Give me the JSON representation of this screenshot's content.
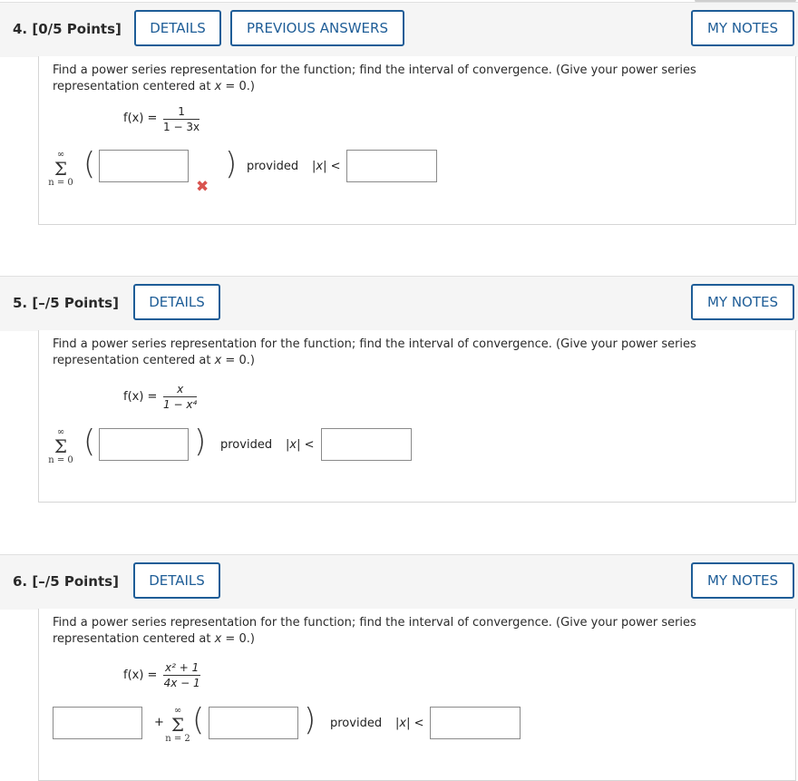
{
  "questions": [
    {
      "number_label": "4. [0/5 Points]",
      "details_label": "DETAILS",
      "previous_answers_label": "PREVIOUS ANSWERS",
      "my_notes_label": "MY NOTES",
      "prompt_part1": "Find a power series representation for the function; find the interval of convergence. (Give your power series representation centered at ",
      "prompt_var": "x",
      "prompt_part2": " = 0.)",
      "fx_label": "f(x) =",
      "numerator": "1",
      "denominator": "1 − 3x",
      "sum_upper": "∞",
      "sum_symbol": "Σ",
      "sum_lower": "n = 0",
      "provided_label": "provided",
      "abs_x": "|x| <",
      "status": "incorrect",
      "status_icon": "✖"
    },
    {
      "number_label": "5. [–/5 Points]",
      "details_label": "DETAILS",
      "my_notes_label": "MY NOTES",
      "prompt_part1": "Find a power series representation for the function; find the interval of convergence. (Give your power series representation centered at ",
      "prompt_var": "x",
      "prompt_part2": " = 0.)",
      "fx_label": "f(x) =",
      "numerator": "x",
      "denominator": "1 − x⁴",
      "sum_upper": "∞",
      "sum_symbol": "Σ",
      "sum_lower": "n = 0",
      "provided_label": "provided",
      "abs_x": "|x| <"
    },
    {
      "number_label": "6. [–/5 Points]",
      "details_label": "DETAILS",
      "my_notes_label": "MY NOTES",
      "prompt_part1": "Find a power series representation for the function; find the interval of convergence. (Give your power series representation centered at ",
      "prompt_var": "x",
      "prompt_part2": " = 0.)",
      "fx_label": "f(x) =",
      "numerator": "x² + 1",
      "denominator": "4x − 1",
      "plus": "+",
      "sum_upper": "∞",
      "sum_symbol": "Σ",
      "sum_lower": "n = 2",
      "provided_label": "provided",
      "abs_x": "|x| <"
    }
  ],
  "colors": {
    "accent": "#1e5d97",
    "incorrect": "#d9534f",
    "header_bg": "#f5f5f5"
  }
}
